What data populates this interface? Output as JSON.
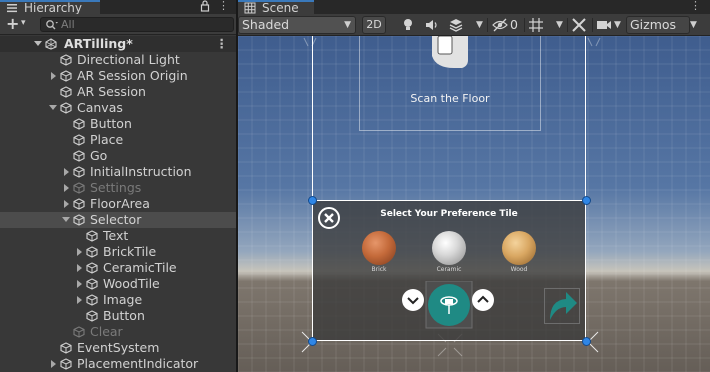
{
  "hierarchy": {
    "tab_label": "Hierarchy",
    "add_label": "+",
    "search_placeholder": "All",
    "scene_name": "ARTilling*",
    "items": [
      {
        "label": "Directional Light",
        "depth": 1,
        "arrow": false,
        "dim": false
      },
      {
        "label": "AR Session Origin",
        "depth": 1,
        "arrow": true,
        "dim": false
      },
      {
        "label": "AR Session",
        "depth": 1,
        "arrow": false,
        "dim": false
      },
      {
        "label": "Canvas",
        "depth": 1,
        "arrow": "open",
        "dim": false
      },
      {
        "label": "Button",
        "depth": 2,
        "arrow": false,
        "dim": false
      },
      {
        "label": "Place",
        "depth": 2,
        "arrow": false,
        "dim": false
      },
      {
        "label": "Go",
        "depth": 2,
        "arrow": false,
        "dim": false
      },
      {
        "label": "InitialInstruction",
        "depth": 2,
        "arrow": true,
        "dim": false
      },
      {
        "label": "Settings",
        "depth": 2,
        "arrow": true,
        "dim": true
      },
      {
        "label": "FloorArea",
        "depth": 2,
        "arrow": true,
        "dim": false
      },
      {
        "label": "Selector",
        "depth": 2,
        "arrow": "open",
        "dim": false,
        "selected": true
      },
      {
        "label": "Text",
        "depth": 3,
        "arrow": false,
        "dim": false
      },
      {
        "label": "BrickTile",
        "depth": 3,
        "arrow": true,
        "dim": false
      },
      {
        "label": "CeramicTile",
        "depth": 3,
        "arrow": true,
        "dim": false
      },
      {
        "label": "WoodTile",
        "depth": 3,
        "arrow": true,
        "dim": false
      },
      {
        "label": "Image",
        "depth": 3,
        "arrow": true,
        "dim": false
      },
      {
        "label": "Button",
        "depth": 3,
        "arrow": false,
        "dim": false
      },
      {
        "label": "Clear",
        "depth": 2,
        "arrow": false,
        "dim": true
      },
      {
        "label": "EventSystem",
        "depth": 1,
        "arrow": false,
        "dim": false
      },
      {
        "label": "PlacementIndicator",
        "depth": 1,
        "arrow": true,
        "dim": false
      }
    ]
  },
  "scene": {
    "tab_label": "Scene",
    "shading_mode": "Shaded",
    "mode_2d": "2D",
    "hidden_count": "0",
    "gizmos_label": "Gizmos",
    "toolbar_icons": [
      "light-bulb-icon",
      "audio-icon",
      "effects-stack-icon",
      "visibility-eye-icon",
      "grid-snap-icon",
      "tools-icon",
      "camera-icon"
    ],
    "canvas": {
      "instruction_text": "Scan the Floor",
      "selector_title": "Select Your Preference Tile",
      "tiles": [
        {
          "label": "Brick",
          "color": "#c46a3a"
        },
        {
          "label": "Ceramic",
          "color": "#d8d8d8"
        },
        {
          "label": "Wood",
          "color": "#d9a762"
        }
      ],
      "accent_color": "#1f8a84"
    }
  },
  "colors": {
    "panel_bg": "#383838",
    "toolbar_bg": "#3c3c3c",
    "selected_row": "#4c4c4c",
    "tab_accent": "#3a79bb",
    "handle_blue": "#2f86e6"
  }
}
